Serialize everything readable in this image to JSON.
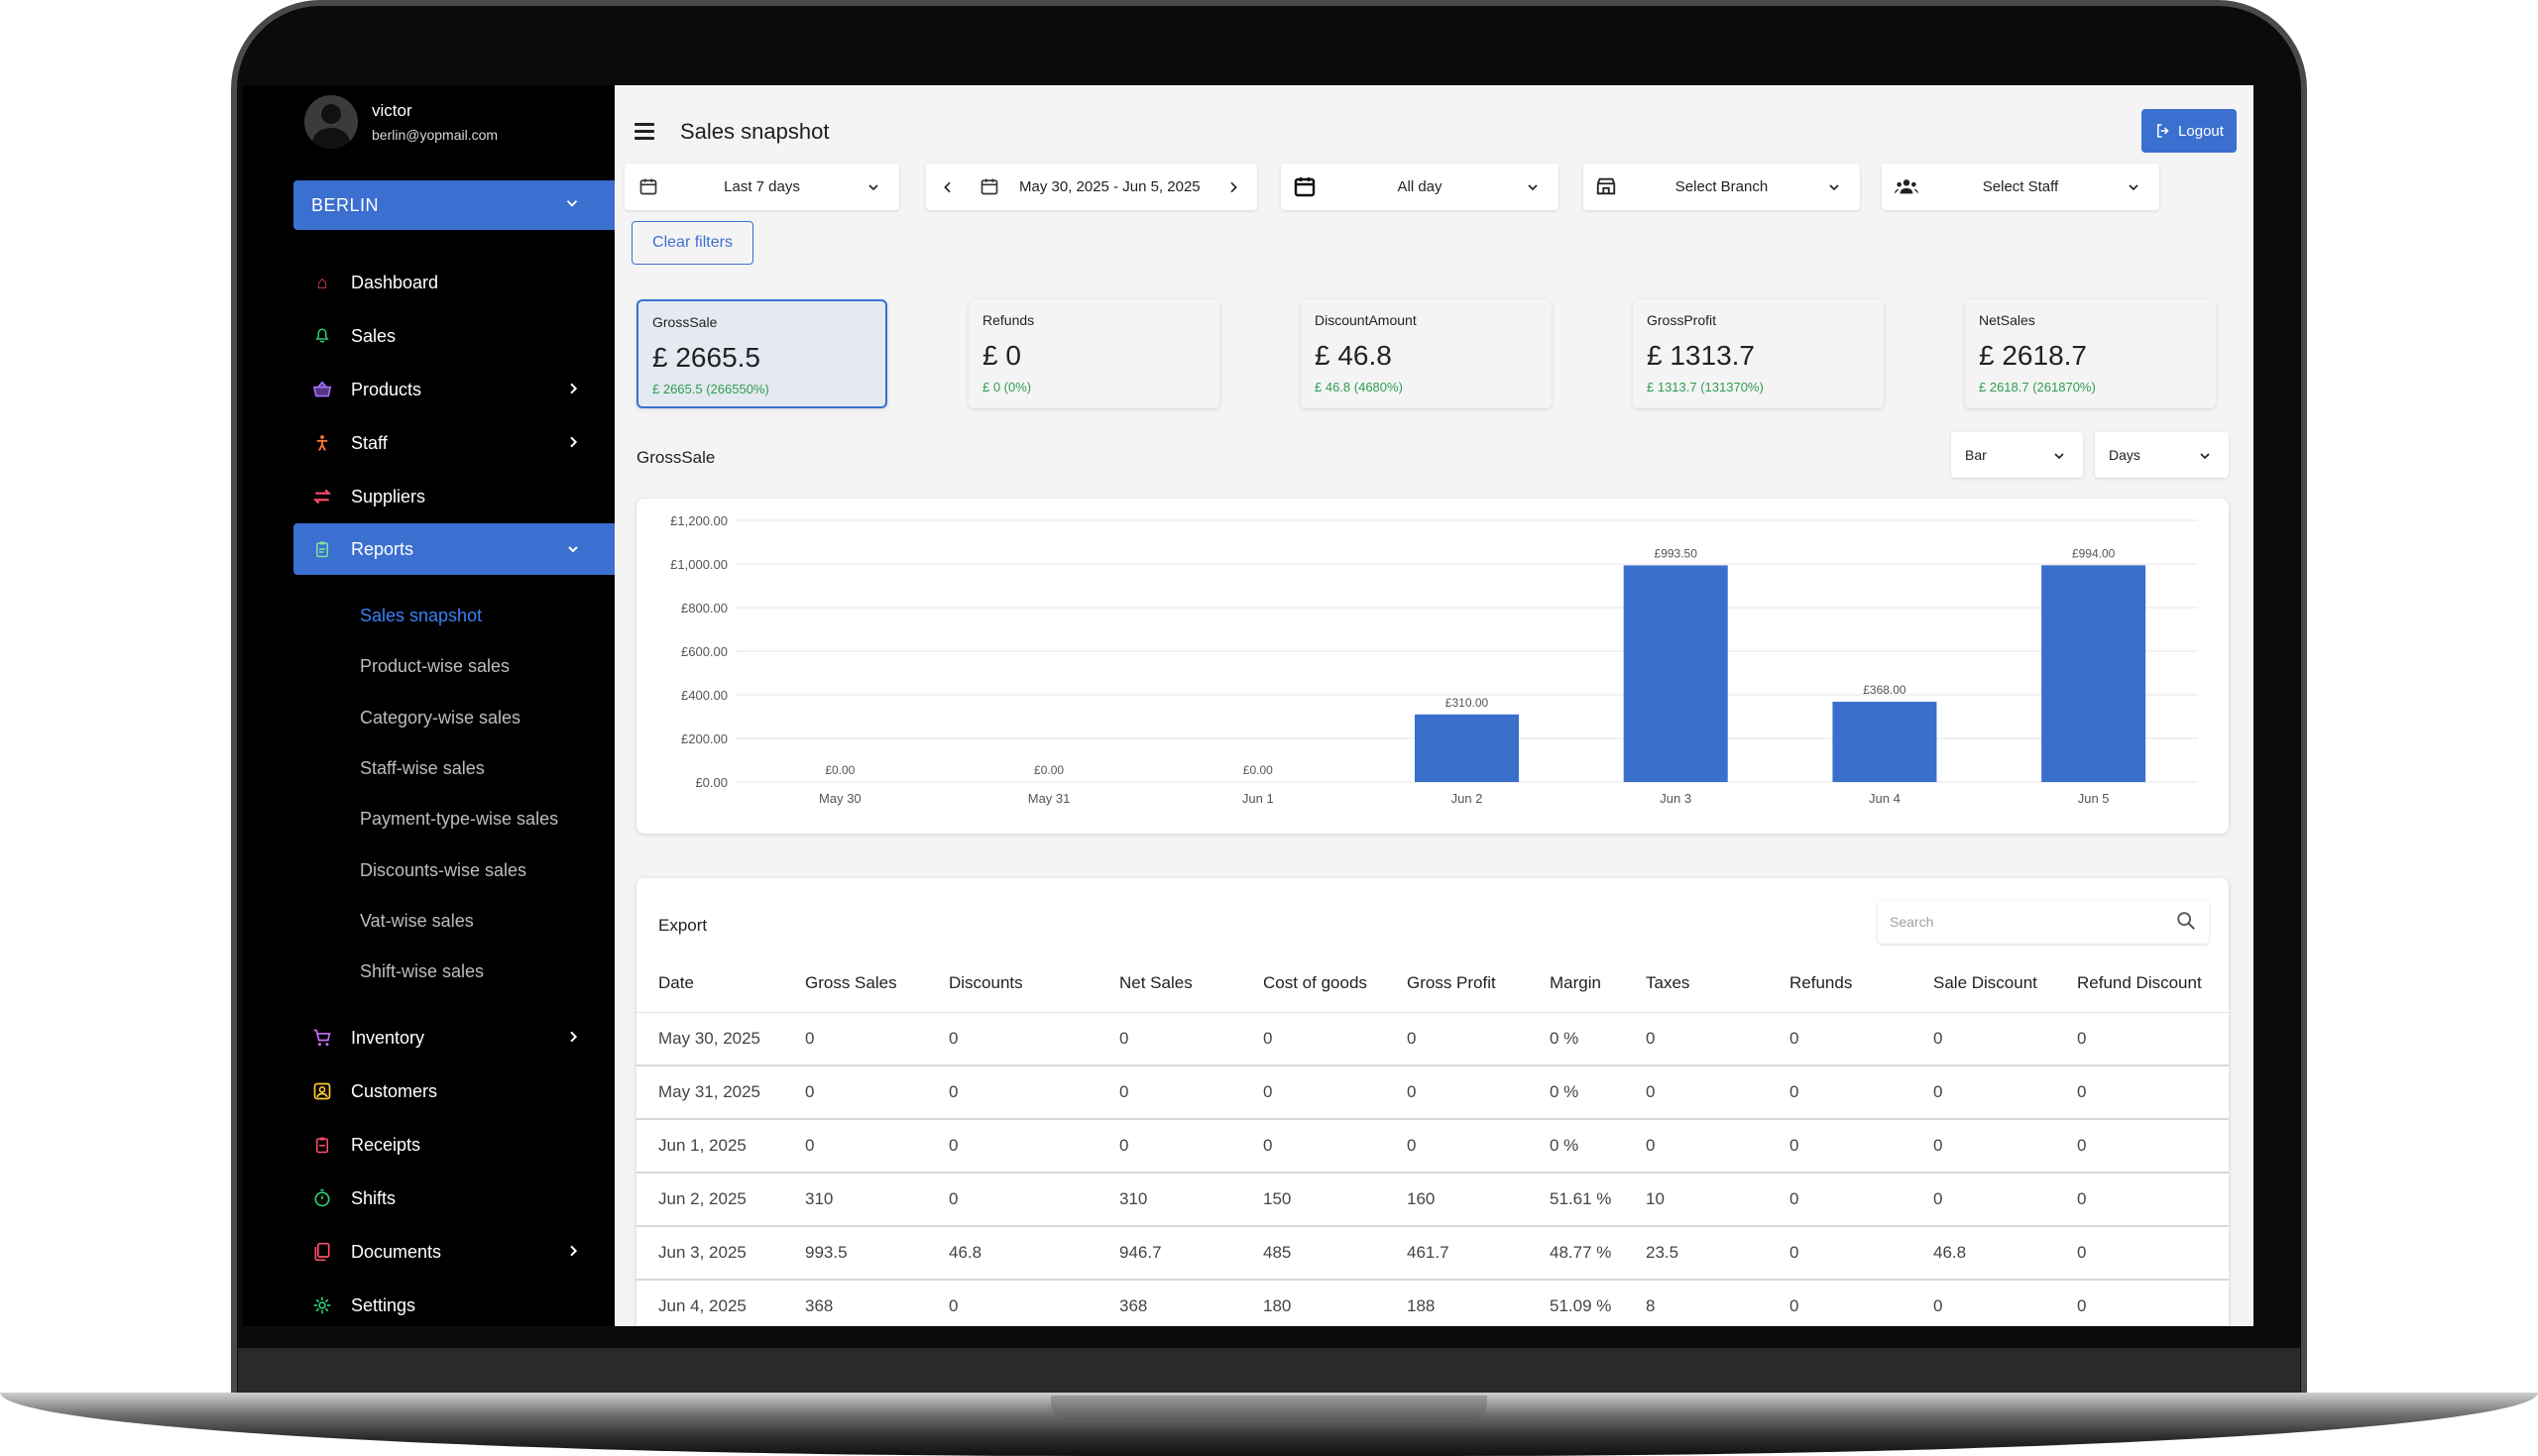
{
  "profile": {
    "name": "victor",
    "email": "berlin@yopmail.com"
  },
  "branch": "BERLIN",
  "nav": [
    {
      "label": "Dashboard",
      "icon": "home-icon",
      "glyph": "⌂",
      "color": "#e84a5f"
    },
    {
      "label": "Sales",
      "icon": "bell-icon",
      "glyph": "🔔",
      "color": "#2ecc71"
    },
    {
      "label": "Products",
      "icon": "basket-icon",
      "glyph": "🧺",
      "color": "#a66bff"
    },
    {
      "label": "Staff",
      "icon": "person-icon",
      "glyph": "🏃",
      "color": "#ff7a2f"
    },
    {
      "label": "Suppliers",
      "icon": "swap-icon",
      "glyph": "⇆",
      "color": "#ff4d6d"
    },
    {
      "label": "Reports",
      "icon": "clipboard-icon",
      "glyph": "📋",
      "color": "#7fe3a1"
    }
  ],
  "subnav": [
    "Sales snapshot",
    "Product-wise sales",
    "Category-wise sales",
    "Staff-wise sales",
    "Payment-type-wise sales",
    "Discounts-wise sales",
    "Vat-wise sales",
    "Shift-wise sales"
  ],
  "nav2": [
    {
      "label": "Inventory",
      "icon": "cart-icon",
      "glyph": "🛒",
      "color": "#c86bff"
    },
    {
      "label": "Customers",
      "icon": "contact-icon",
      "glyph": "👤",
      "color": "#ffcc33"
    },
    {
      "label": "Receipts",
      "icon": "receipt-icon",
      "glyph": "🧾",
      "color": "#ff4d6d"
    },
    {
      "label": "Shifts",
      "icon": "timer-icon",
      "glyph": "⏱",
      "color": "#2ecc71"
    },
    {
      "label": "Documents",
      "icon": "documents-icon",
      "glyph": "📑",
      "color": "#ff4d6d"
    },
    {
      "label": "Settings",
      "icon": "gear-icon",
      "glyph": "⚙",
      "color": "#2ecc71"
    }
  ],
  "header": {
    "title": "Sales snapshot",
    "logout": "Logout"
  },
  "filters": {
    "period": "Last 7 days",
    "date_range": "May 30, 2025 - Jun 5, 2025",
    "time": "All day",
    "branch": "Select Branch",
    "staff": "Select Staff",
    "clear": "Clear filters"
  },
  "cards": [
    {
      "title": "GrossSale",
      "value": "£ 2665.5",
      "sub": "£ 2665.5 (266550%)"
    },
    {
      "title": "Refunds",
      "value": "£ 0",
      "sub": "£ 0 (0%)"
    },
    {
      "title": "DiscountAmount",
      "value": "£ 46.8",
      "sub": "£ 46.8 (4680%)"
    },
    {
      "title": "GrossProfit",
      "value": "£ 1313.7",
      "sub": "£ 1313.7 (131370%)"
    },
    {
      "title": "NetSales",
      "value": "£ 2618.7",
      "sub": "£ 2618.7 (261870%)"
    }
  ],
  "chart_section": {
    "label": "GrossSale",
    "chart_type_select": "Bar",
    "period_select": "Days"
  },
  "colors": {
    "accent": "#3b6fd0",
    "bar": "#3a6fcb",
    "positive": "#2e9e4f"
  },
  "chart_data": {
    "type": "bar",
    "categories": [
      "May 30",
      "May 31",
      "Jun 1",
      "Jun 2",
      "Jun 3",
      "Jun 4",
      "Jun 5"
    ],
    "values": [
      0,
      0,
      0,
      310,
      993.5,
      368,
      994
    ],
    "value_labels": [
      "£0.00",
      "£0.00",
      "£0.00",
      "£310.00",
      "£993.50",
      "£368.00",
      "£994.00"
    ],
    "yticks": [
      0,
      200,
      400,
      600,
      800,
      1000,
      1200
    ],
    "ytick_labels": [
      "£0.00",
      "£200.00",
      "£400.00",
      "£600.00",
      "£800.00",
      "£1,000.00",
      "£1,200.00"
    ],
    "ylim": [
      0,
      1200
    ],
    "grid": true
  },
  "table": {
    "export_label": "Export",
    "search_placeholder": "Search",
    "columns": [
      "Date",
      "Gross Sales",
      "Discounts",
      "Net Sales",
      "Cost of goods",
      "Gross Profit",
      "Margin",
      "Taxes",
      "Refunds",
      "Sale Discount",
      "Refund Discount"
    ],
    "rows": [
      [
        "May 30, 2025",
        "0",
        "0",
        "0",
        "0",
        "0",
        "0 %",
        "0",
        "0",
        "0",
        "0"
      ],
      [
        "May 31, 2025",
        "0",
        "0",
        "0",
        "0",
        "0",
        "0 %",
        "0",
        "0",
        "0",
        "0"
      ],
      [
        "Jun 1, 2025",
        "0",
        "0",
        "0",
        "0",
        "0",
        "0 %",
        "0",
        "0",
        "0",
        "0"
      ],
      [
        "Jun 2, 2025",
        "310",
        "0",
        "310",
        "150",
        "160",
        "51.61 %",
        "10",
        "0",
        "0",
        "0"
      ],
      [
        "Jun 3, 2025",
        "993.5",
        "46.8",
        "946.7",
        "485",
        "461.7",
        "48.77 %",
        "23.5",
        "0",
        "46.8",
        "0"
      ],
      [
        "Jun 4, 2025",
        "368",
        "0",
        "368",
        "180",
        "188",
        "51.09 %",
        "8",
        "0",
        "0",
        "0"
      ]
    ]
  }
}
